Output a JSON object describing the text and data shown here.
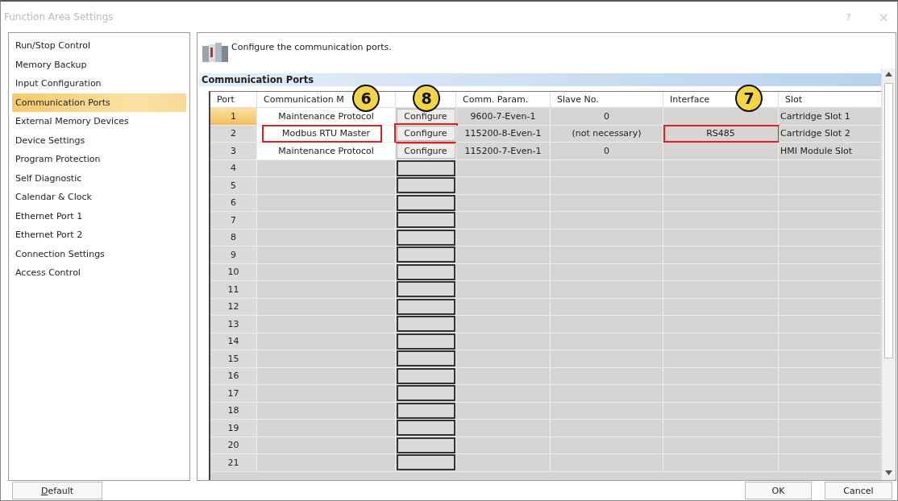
{
  "window": {
    "title": "Function Area Settings",
    "help": "?",
    "close": "×"
  },
  "sidebar": {
    "items": [
      {
        "label": "Run/Stop Control",
        "selected": false
      },
      {
        "label": "Memory Backup",
        "selected": false
      },
      {
        "label": "Input Configuration",
        "selected": false
      },
      {
        "label": "Communication Ports",
        "selected": true
      },
      {
        "label": "External Memory Devices",
        "selected": false
      },
      {
        "label": "Device Settings",
        "selected": false
      },
      {
        "label": "Program Protection",
        "selected": false
      },
      {
        "label": "Self Diagnostic",
        "selected": false
      },
      {
        "label": "Calendar & Clock",
        "selected": false
      },
      {
        "label": "Ethernet Port 1",
        "selected": false
      },
      {
        "label": "Ethernet Port 2",
        "selected": false
      },
      {
        "label": "Connection Settings",
        "selected": false
      },
      {
        "label": "Access Control",
        "selected": false
      }
    ]
  },
  "header": {
    "text": "Configure the communication ports."
  },
  "section": {
    "title": "Communication Ports"
  },
  "table": {
    "columns": [
      {
        "label": "Port"
      },
      {
        "label": "Communication M",
        "callout": "6"
      },
      {
        "callout": "8"
      },
      {
        "label": "Comm. Param."
      },
      {
        "label": "Slave No."
      },
      {
        "label": "Interface",
        "callout": "7"
      },
      {
        "label": "Slot"
      }
    ],
    "rows": [
      {
        "kind": "filled",
        "port": "1",
        "selected": true,
        "marked": false,
        "mode": "Maintenance Protocol",
        "button": "Configure",
        "param": "9600-7-Even-1",
        "slave": "0",
        "slot": "Cartridge Slot 1"
      },
      {
        "kind": "filled",
        "port": "2",
        "selected": false,
        "marked": true,
        "mode": "Modbus RTU Master",
        "button": "Configure",
        "param": "115200-8-Even-1",
        "slave": "(not necessary)",
        "interface": "RS485",
        "slot": "Cartridge Slot 2"
      },
      {
        "kind": "filled",
        "port": "3",
        "selected": false,
        "marked": false,
        "mode": "Maintenance Protocol",
        "button": "Configure",
        "param": "115200-7-Even-1",
        "slave": "0",
        "slot": "HMI Module Slot"
      },
      {
        "kind": "blank",
        "port": "4",
        "selected": false,
        "marked": false
      },
      {
        "kind": "blank",
        "port": "5",
        "selected": false,
        "marked": false
      },
      {
        "kind": "blank",
        "port": "6",
        "selected": false,
        "marked": false
      },
      {
        "kind": "blank",
        "port": "7",
        "selected": false,
        "marked": false
      },
      {
        "kind": "blank",
        "port": "8",
        "selected": false,
        "marked": false
      },
      {
        "kind": "blank",
        "port": "9",
        "selected": false,
        "marked": false
      },
      {
        "kind": "blank",
        "port": "10",
        "selected": false,
        "marked": false
      },
      {
        "kind": "blank",
        "port": "11",
        "selected": false,
        "marked": false
      },
      {
        "kind": "blank",
        "port": "12",
        "selected": false,
        "marked": false
      },
      {
        "kind": "blank",
        "port": "13",
        "selected": false,
        "marked": false
      },
      {
        "kind": "blank",
        "port": "14",
        "selected": false,
        "marked": false
      },
      {
        "kind": "blank",
        "port": "15",
        "selected": false,
        "marked": false
      },
      {
        "kind": "blank",
        "port": "16",
        "selected": false,
        "marked": false
      },
      {
        "kind": "blank",
        "port": "17",
        "selected": false,
        "marked": false
      },
      {
        "kind": "blank",
        "port": "18",
        "selected": false,
        "marked": false
      },
      {
        "kind": "blank",
        "port": "19",
        "selected": false,
        "marked": false
      },
      {
        "kind": "blank",
        "port": "20",
        "selected": false,
        "marked": false
      },
      {
        "kind": "blank",
        "port": "21",
        "selected": false,
        "marked": false
      }
    ]
  },
  "buttons": {
    "default": "Default",
    "ok": "OK",
    "cancel": "Cancel"
  }
}
